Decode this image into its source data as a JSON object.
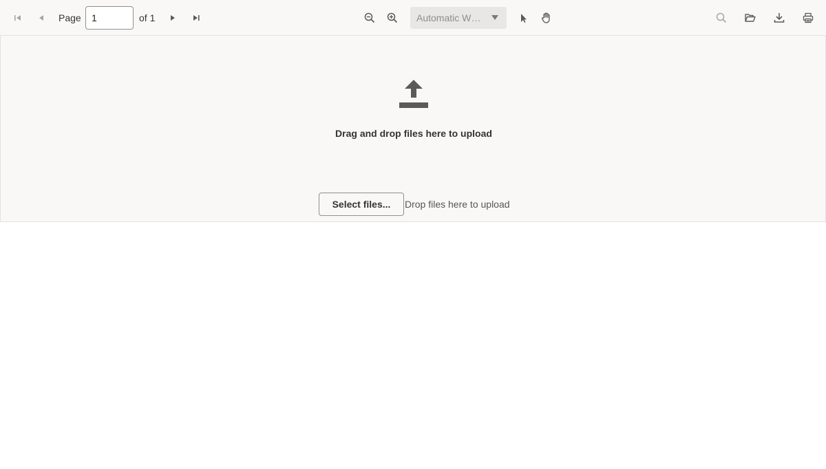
{
  "toolbar": {
    "page_label": "Page",
    "page_value": "1",
    "page_total": "of 1",
    "zoom_value": "Automatic Width",
    "icons": {
      "first_page": "first-page-icon",
      "previous_page": "previous-page-icon",
      "next_page": "next-page-icon",
      "last_page": "last-page-icon",
      "zoom_out": "zoom-out-icon",
      "zoom_in": "zoom-in-icon",
      "select_tool": "cursor-arrow-icon",
      "hand_tool": "hand-icon",
      "search": "search-icon",
      "open_file": "folder-open-icon",
      "download": "download-icon",
      "print": "print-icon"
    }
  },
  "dropzone": {
    "title": "Drag and drop files here to upload",
    "select_button": "Select files...",
    "hint": "Drop files here to upload",
    "icon": "upload-icon"
  },
  "colors": {
    "toolbar_bg": "#f9f8f7",
    "icon": "#5c5a58",
    "icon_disabled": "#a8a6a4",
    "select_bg": "#e9e7e5"
  }
}
